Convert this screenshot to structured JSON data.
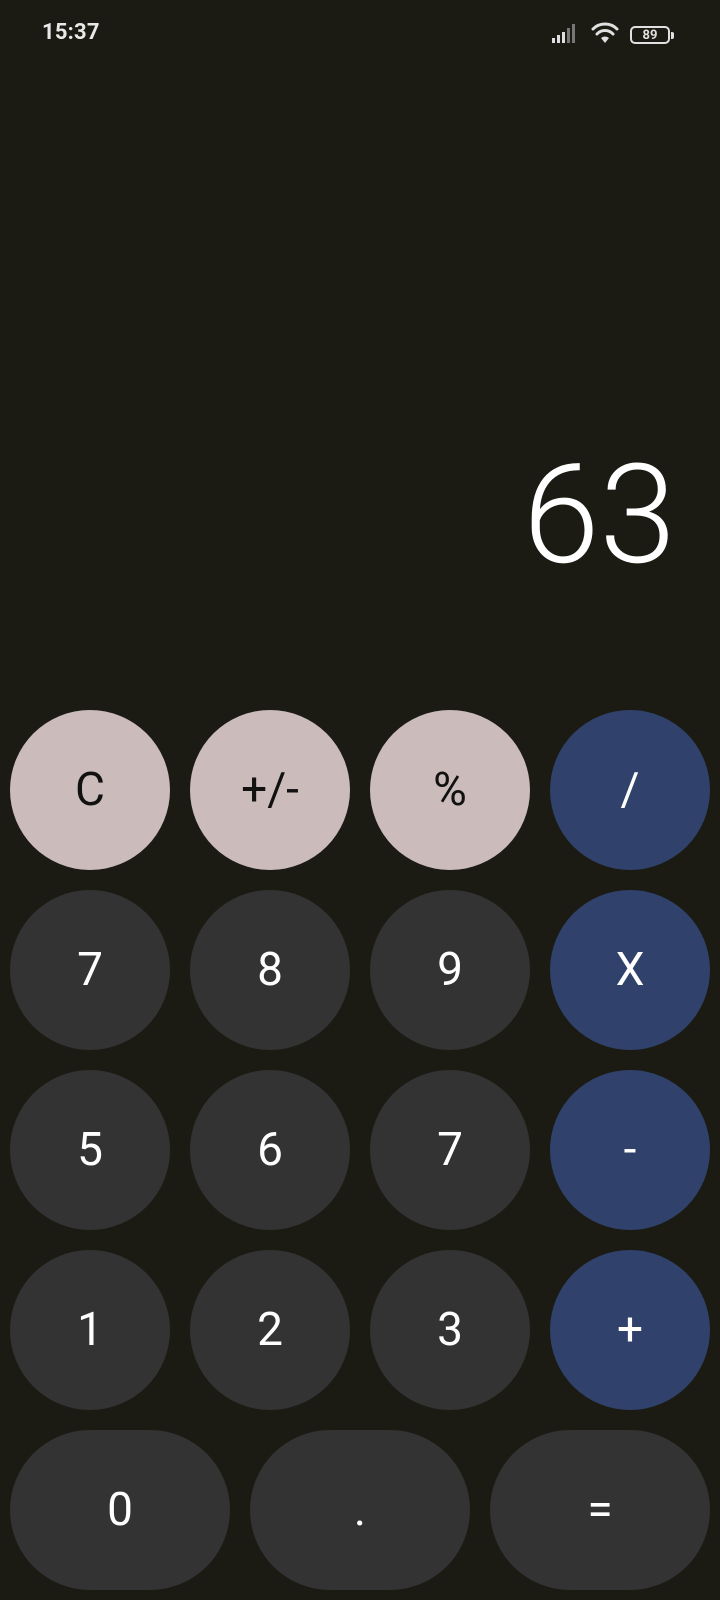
{
  "status_bar": {
    "time": "15:37",
    "battery": "89",
    "icons": [
      "signal-icon",
      "wifi-icon",
      "battery-icon"
    ]
  },
  "display": {
    "value": "63"
  },
  "keys": {
    "clear": "C",
    "sign": "+/-",
    "percent": "%",
    "divide": "/",
    "seven": "7",
    "eight": "8",
    "nine": "9",
    "multiply": "X",
    "five": "5",
    "six": "6",
    "seven_b": "7",
    "minus": "-",
    "one": "1",
    "two": "2",
    "three": "3",
    "plus": "+",
    "zero": "0",
    "dot": ".",
    "equals": "="
  },
  "colors": {
    "background": "#1b1b14",
    "function_key": "#cbbcbb",
    "operator_key": "#30426b",
    "number_key": "#333333"
  }
}
